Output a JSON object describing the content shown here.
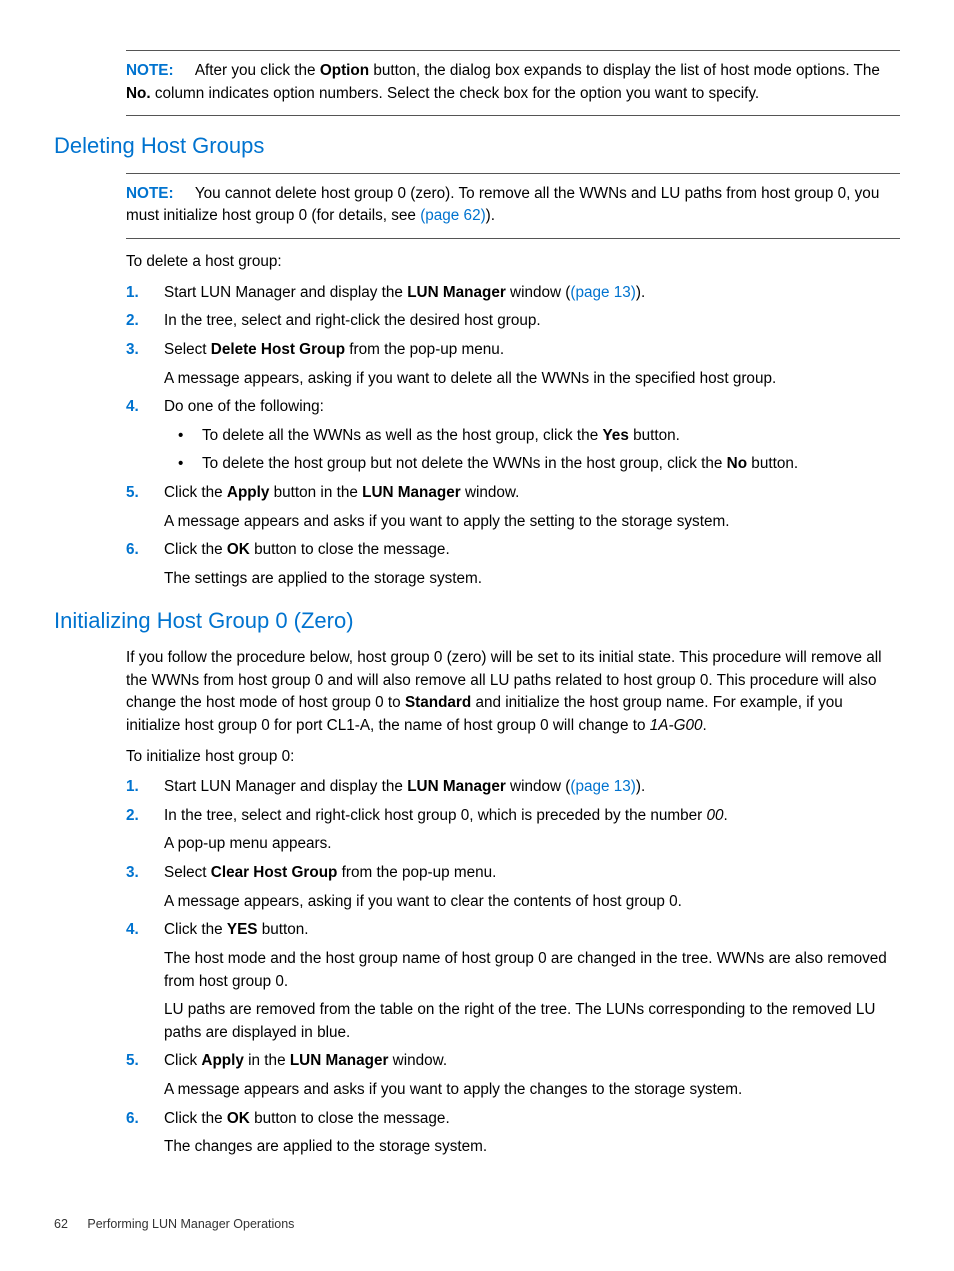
{
  "topnote": {
    "label": "NOTE:",
    "text_1": "After you click the ",
    "text_2": "Option",
    "text_3": " button, the dialog box expands to display the list of host mode options. The ",
    "text_4": "No.",
    "text_5": " column indicates option numbers. Select the check box for the option you want to specify."
  },
  "section1": {
    "heading": "Deleting Host Groups",
    "note": {
      "label": "NOTE:",
      "t1": "You cannot delete host group 0 (zero). To remove all the WWNs and LU paths from host group 0, you must initialize host group 0 (for details, see ",
      "link": "(page 62)",
      "t2": ")."
    },
    "intro": "To delete a host group:",
    "s1_a": "Start LUN Manager and display the ",
    "s1_b": "LUN Manager",
    "s1_c": " window (",
    "s1_link": "(page 13)",
    "s1_d": ").",
    "s2": "In the tree, select and right-click the desired host group.",
    "s3_a": "Select ",
    "s3_b": "Delete Host Group",
    "s3_c": " from the pop-up menu.",
    "s3_sub": "A message appears, asking if you want to delete all the WWNs in the specified host group.",
    "s4": "Do one of the following:",
    "s4_b1_a": "To delete all the WWNs as well as the host group, click the ",
    "s4_b1_b": "Yes",
    "s4_b1_c": " button.",
    "s4_b2_a": "To delete the host group but not delete the WWNs in the host group, click the ",
    "s4_b2_b": "No",
    "s4_b2_c": " button.",
    "s5_a": "Click the ",
    "s5_b": "Apply",
    "s5_c": " button in the ",
    "s5_d": "LUN Manager",
    "s5_e": " window.",
    "s5_sub": "A message appears and asks if you want to apply the setting to the storage system.",
    "s6_a": "Click the ",
    "s6_b": "OK",
    "s6_c": " button to close the message.",
    "s6_sub": "The settings are applied to the storage system."
  },
  "section2": {
    "heading": "Initializing Host Group 0 (Zero)",
    "p1_a": "If you follow the procedure below, host group 0 (zero) will be set to its initial state. This procedure will remove all the WWNs from host group 0 and will also remove all LU paths related to host group 0. This procedure will also change the host mode of host group 0 to ",
    "p1_b": "Standard",
    "p1_c": " and initialize the host group name. For example, if you initialize host group 0 for port CL1-A, the name of host group 0 will change to ",
    "p1_d": "1A-G00",
    "p1_e": ".",
    "intro": "To initialize host group 0:",
    "s1_a": "Start LUN Manager and display the ",
    "s1_b": "LUN Manager",
    "s1_c": " window (",
    "s1_link": "(page 13)",
    "s1_d": ").",
    "s2_a": "In the tree, select and right-click host group 0, which is preceded by the number ",
    "s2_b": "00",
    "s2_c": ".",
    "s2_sub": "A pop-up menu appears.",
    "s3_a": "Select ",
    "s3_b": "Clear Host Group",
    "s3_c": " from the pop-up menu.",
    "s3_sub": "A message appears, asking if you want to clear the contents of host group 0.",
    "s4_a": "Click the ",
    "s4_b": "YES",
    "s4_c": " button.",
    "s4_sub1": "The host mode and the host group name of host group 0 are changed in the tree. WWNs are also removed from host group 0.",
    "s4_sub2": "LU paths are removed from the table on the right of the tree. The LUNs corresponding to the removed LU paths are displayed in blue.",
    "s5_a": "Click ",
    "s5_b": "Apply",
    "s5_c": " in the ",
    "s5_d": "LUN Manager",
    "s5_e": " window.",
    "s5_sub": "A message appears and asks if you want to apply the changes to the storage system.",
    "s6_a": "Click the ",
    "s6_b": "OK",
    "s6_c": " button to close the message.",
    "s6_sub": "The changes are applied to the storage system."
  },
  "footer": {
    "page": "62",
    "title": "Performing LUN Manager Operations"
  }
}
